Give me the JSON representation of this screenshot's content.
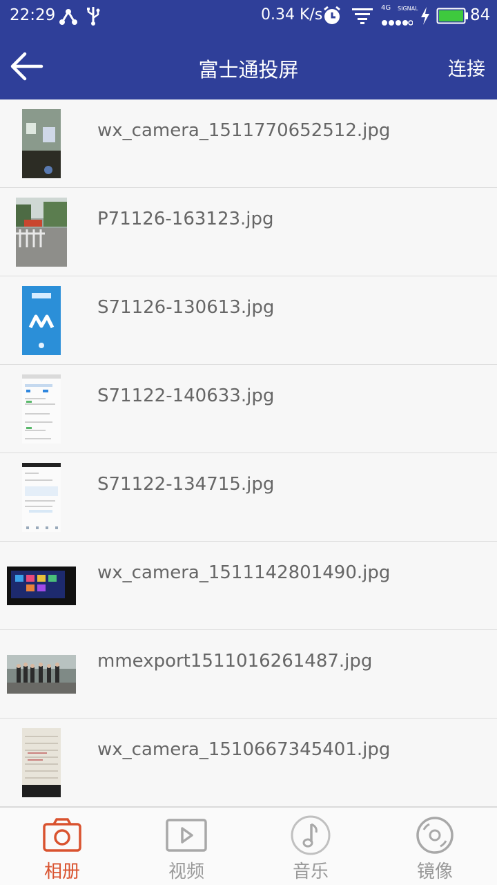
{
  "status_bar": {
    "time": "22:29",
    "speed": "0.34 K/s",
    "network": "4G",
    "signal_label": "SIGNAL",
    "battery": "84"
  },
  "app_bar": {
    "title": "富士通投屏",
    "action_label": "连接",
    "back_icon": "arrow-left-icon"
  },
  "files": [
    {
      "name": "wx_camera_1511770652512.jpg",
      "thumb_kind": "portrait-narrow",
      "thumb_style": "projector"
    },
    {
      "name": "P71126-163123.jpg",
      "thumb_kind": "portrait-wide",
      "thumb_style": "street"
    },
    {
      "name": "S71126-130613.jpg",
      "thumb_kind": "portrait-narrow",
      "thumb_style": "blue-app"
    },
    {
      "name": "S71122-140633.jpg",
      "thumb_kind": "portrait-narrow",
      "thumb_style": "screenshot-a"
    },
    {
      "name": "S71122-134715.jpg",
      "thumb_kind": "portrait-narrow",
      "thumb_style": "screenshot-b"
    },
    {
      "name": "wx_camera_1511142801490.jpg",
      "thumb_kind": "landscape",
      "thumb_style": "tv-screen"
    },
    {
      "name": "mmexport1511016261487.jpg",
      "thumb_kind": "landscape",
      "thumb_style": "group-photo"
    },
    {
      "name": "wx_camera_1510667345401.jpg",
      "thumb_kind": "portrait-narrow",
      "thumb_style": "paper"
    }
  ],
  "tabs": [
    {
      "label": "相册",
      "icon": "camera-icon",
      "active": true
    },
    {
      "label": "视频",
      "icon": "play-icon",
      "active": false
    },
    {
      "label": "音乐",
      "icon": "music-note-icon",
      "active": false
    },
    {
      "label": "镜像",
      "icon": "disc-icon",
      "active": false
    }
  ],
  "colors": {
    "primary": "#2f3f99",
    "active_tab": "#d9532f",
    "inactive_tab": "#999999",
    "filename_text": "#666666",
    "battery_fill": "#3ec93e"
  }
}
